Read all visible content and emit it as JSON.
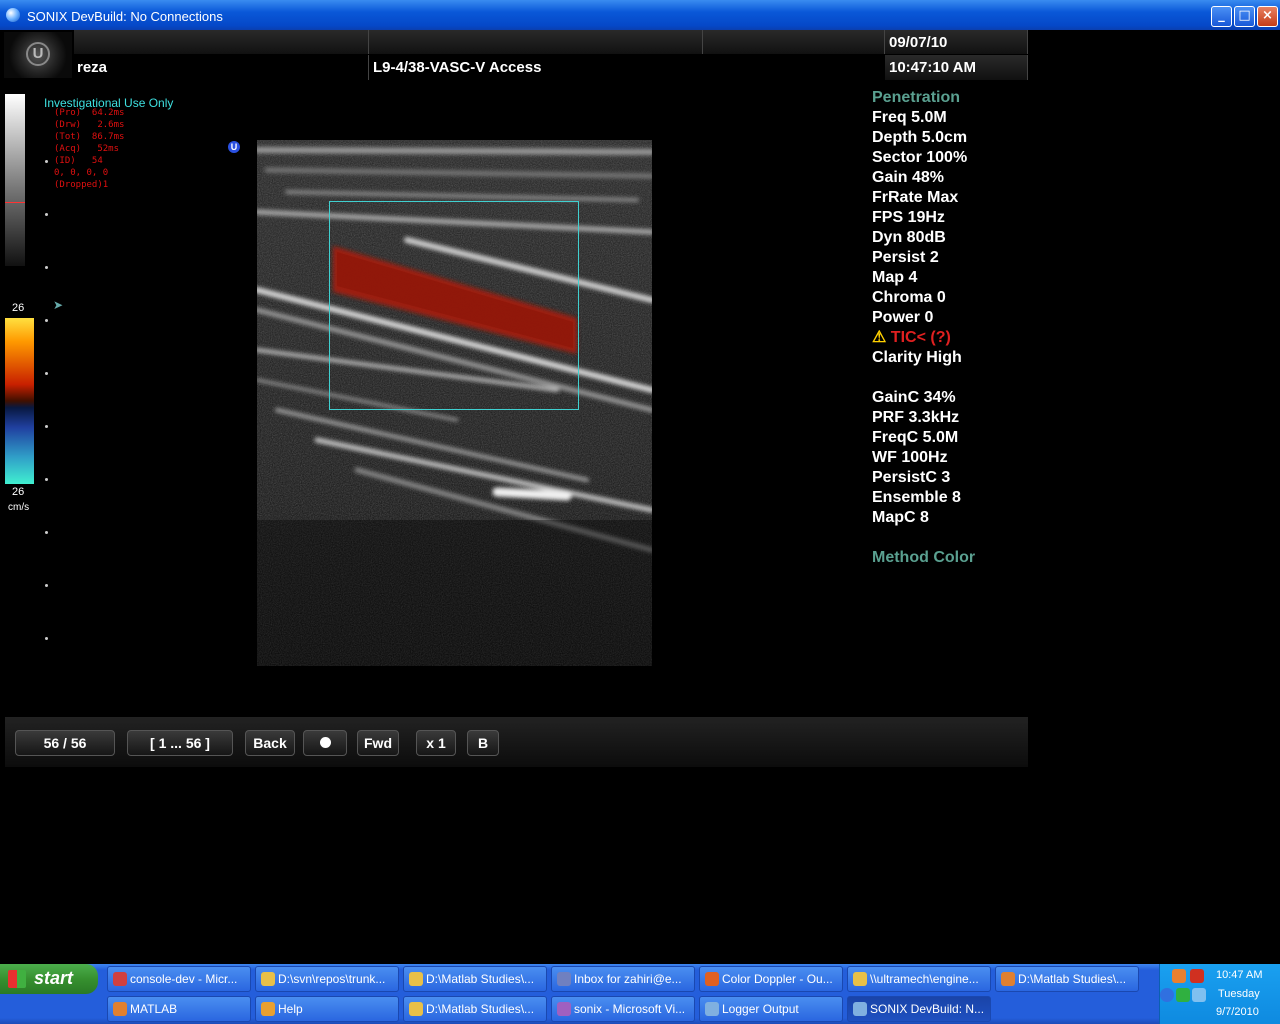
{
  "window": {
    "title": "SONIX DevBuild: No Connections"
  },
  "header": {
    "user": "reza",
    "probe": "L9-4/38-VASC-V Access",
    "date": "09/07/10",
    "time": "10:47:10 AM"
  },
  "color_scale": {
    "top": "26",
    "bottom": "26",
    "unit": "cm/s"
  },
  "overlay": {
    "investigational": "Investigational Use Only",
    "stats": [
      "(Pro)  64.2ms",
      "(Drw)   2.6ms",
      "(Tot)  86.7ms",
      "(Acq)   52ms",
      "(ID)   54",
      "0, 0, 0, 0",
      "(Dropped)1"
    ],
    "u_badge": "U"
  },
  "params": {
    "penetration": "Penetration",
    "freq": "Freq 5.0M",
    "depth": "Depth 5.0cm",
    "sector": "Sector 100%",
    "gain": "Gain 48%",
    "frrate": "FrRate Max",
    "fps": "FPS 19Hz",
    "dyn": "Dyn 80dB",
    "persist": "Persist 2",
    "map": "Map 4",
    "chroma": "Chroma 0",
    "power": "Power 0",
    "tic": "TIC< (?)",
    "clarity": "Clarity High",
    "gainc": "GainC 34%",
    "prf": "PRF 3.3kHz",
    "freqc": "FreqC 5.0M",
    "wf": "WF 100Hz",
    "persistc": "PersistC 3",
    "ensemble": "Ensemble 8",
    "mapc": "MapC 8",
    "method": "Method Color"
  },
  "controls": {
    "frame": "56 / 56",
    "range": "[ 1 ... 56 ]",
    "back": "Back",
    "fwd": "Fwd",
    "speed": "x 1",
    "mode": "B"
  },
  "taskbar": {
    "start": "start",
    "row1": [
      "console-dev - Micr...",
      "D:\\svn\\repos\\trunk...",
      "D:\\Matlab Studies\\...",
      "Inbox for zahiri@e...",
      "Color Doppler - Ou...",
      "\\\\ultramech\\engine...",
      "D:\\Matlab Studies\\..."
    ],
    "row2": [
      "MATLAB",
      "Help",
      "D:\\Matlab Studies\\...",
      "sonix - Microsoft Vi...",
      "Logger Output",
      "SONIX DevBuild: N..."
    ],
    "clock": {
      "time": "10:47 AM",
      "day": "Tuesday",
      "date": "9/7/2010"
    }
  },
  "colors": {
    "flow": "#b01808",
    "roi": "#40d0d0",
    "param_title": "#5aa090",
    "warning": "#e02020"
  }
}
